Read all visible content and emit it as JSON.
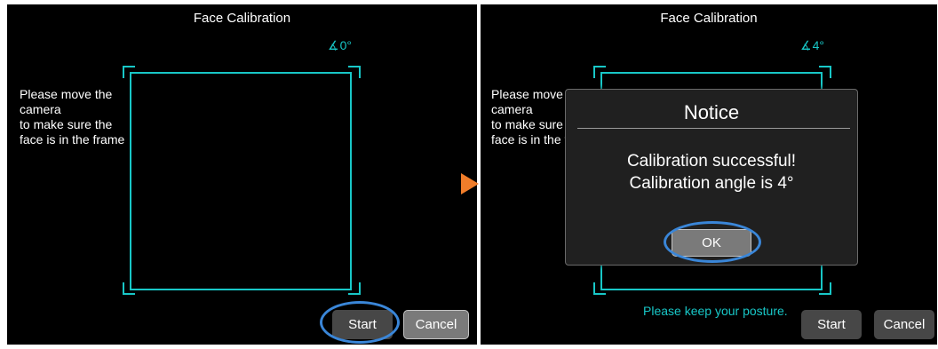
{
  "left": {
    "title": "Face Calibration",
    "angle": "0°",
    "instructions": [
      "Please move the",
      "camera",
      "to make sure the",
      "face is in the frame"
    ],
    "start_label": "Start",
    "cancel_label": "Cancel"
  },
  "right": {
    "title": "Face Calibration",
    "angle": "4°",
    "instructions": [
      "Please move t",
      "camera",
      "to make sure t",
      "face is in the f"
    ],
    "posture_text": "Please keep your posture.",
    "start_label": "Start",
    "cancel_label": "Cancel",
    "dialog": {
      "title": "Notice",
      "message_line1": "Calibration successful!",
      "message_line2": "Calibration angle is 4°",
      "ok_label": "OK"
    }
  },
  "colors": {
    "accent": "#18c7c7",
    "highlight": "#3a86d8",
    "arrow": "#f07d2a"
  },
  "icons": {
    "angle": "angle-icon",
    "transition": "arrow-right-icon"
  }
}
